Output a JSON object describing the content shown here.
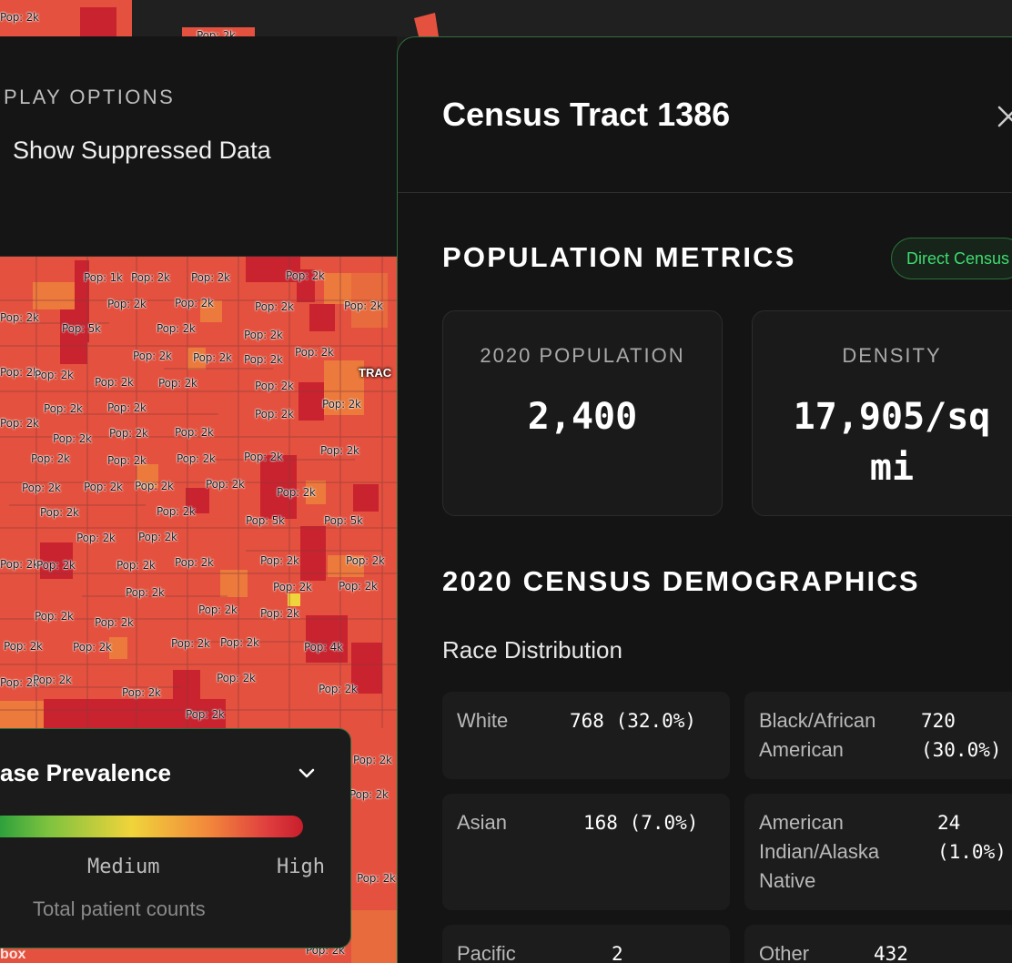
{
  "map": {
    "tract_tag": "TRAC",
    "brand": "box",
    "labels": [
      "Pop: 2k",
      "Pop: 1k",
      "Pop: 5k",
      "Pop: 4k"
    ]
  },
  "display_options": {
    "title": "PLAY OPTIONS",
    "option_label": "Show Suppressed Data"
  },
  "legend": {
    "title": "ase Prevalence",
    "medium_label": "Medium",
    "high_label": "High",
    "subtitle": "Total patient counts",
    "gradient_colors": [
      "#1f9a3b",
      "#7cc23f",
      "#f0d43b",
      "#f2873b",
      "#e0403f",
      "#c81e2c"
    ]
  },
  "detail": {
    "title": "Census Tract 1386",
    "population_section": {
      "title": "POPULATION METRICS",
      "badge": "Direct Census",
      "metrics": [
        {
          "label": "2020 POPULATION",
          "value": "2,400"
        },
        {
          "label": "DENSITY",
          "value": "17,905/sq mi"
        }
      ]
    },
    "demographics_section": {
      "title": "2020 CENSUS DEMOGRAPHICS",
      "subhead": "Race Distribution",
      "races": [
        {
          "name": "White",
          "value": "768 (32.0%)"
        },
        {
          "name": "Black/African American",
          "value": "720 (30.0%)"
        },
        {
          "name": "Asian",
          "value": "168 (7.0%)"
        },
        {
          "name": "American Indian/Alaska Native",
          "value": "24 (1.0%)"
        },
        {
          "name": "Pacific",
          "value": "2"
        },
        {
          "name": "Other",
          "value": "432"
        }
      ]
    }
  },
  "colors": {
    "accent_green": "#3ddc6e",
    "panel_border": "#2f6d3d",
    "map_red": "#e0503f",
    "map_orange": "#ec7a3c",
    "map_dark_red": "#c8232f"
  }
}
